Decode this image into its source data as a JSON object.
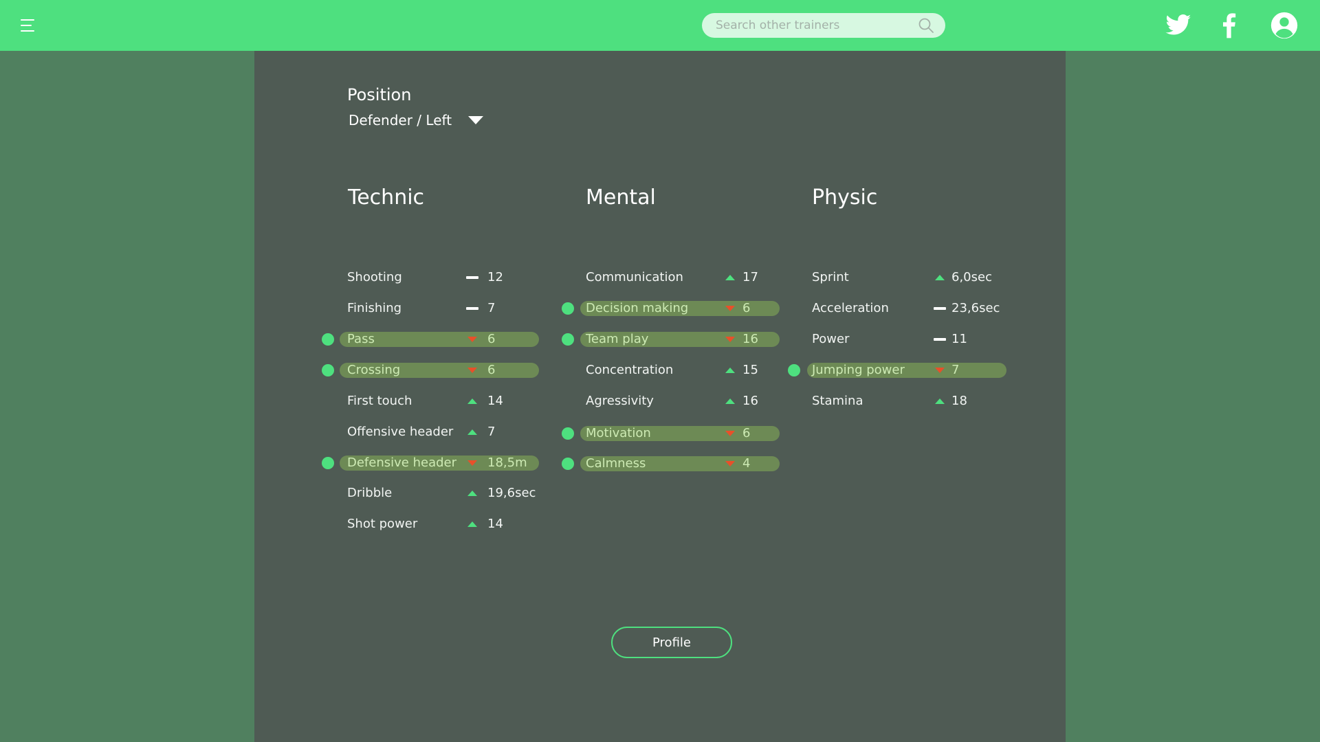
{
  "header": {
    "search": {
      "placeholder": "Search other trainers",
      "value": ""
    },
    "icons": [
      "menu-icon",
      "search-icon",
      "twitter-icon",
      "facebook-icon",
      "user-account-icon"
    ],
    "accent_color": "#4ee07f"
  },
  "position": {
    "label": "Position",
    "value": "Defender / Left"
  },
  "columns": [
    {
      "title": "Technic",
      "stats": [
        {
          "name": "Shooting",
          "trend": "flat",
          "value": "12",
          "flagged": false
        },
        {
          "name": "Finishing",
          "trend": "flat",
          "value": "7",
          "flagged": false
        },
        {
          "name": "Pass",
          "trend": "down",
          "value": "6",
          "flagged": true
        },
        {
          "name": "Crossing",
          "trend": "down",
          "value": "6",
          "flagged": true
        },
        {
          "name": "First touch",
          "trend": "up",
          "value": "14",
          "flagged": false
        },
        {
          "name": "Offensive header",
          "trend": "up",
          "value": "7",
          "flagged": false
        },
        {
          "name": "Defensive header",
          "trend": "down",
          "value": "18,5m",
          "flagged": true
        },
        {
          "name": "Dribble",
          "trend": "up",
          "value": "19,6sec",
          "flagged": false
        },
        {
          "name": "Shot power",
          "trend": "up",
          "value": "14",
          "flagged": false
        }
      ]
    },
    {
      "title": "Mental",
      "stats": [
        {
          "name": "Communication",
          "trend": "up",
          "value": "17",
          "flagged": false
        },
        {
          "name": "Decision making",
          "trend": "down",
          "value": "6",
          "flagged": true
        },
        {
          "name": "Team play",
          "trend": "down",
          "value": "16",
          "flagged": true
        },
        {
          "name": "Concentration",
          "trend": "up",
          "value": "15",
          "flagged": false
        },
        {
          "name": "Agressivity",
          "trend": "up",
          "value": "16",
          "flagged": false
        },
        {
          "name": "Motivation",
          "trend": "down",
          "value": "6",
          "flagged": true
        },
        {
          "name": "Calmness",
          "trend": "down",
          "value": "4",
          "flagged": true
        }
      ]
    },
    {
      "title": "Physic",
      "stats": [
        {
          "name": "Sprint",
          "trend": "up",
          "value": "6,0sec",
          "flagged": false
        },
        {
          "name": "Acceleration",
          "trend": "flat",
          "value": "23,6sec",
          "flagged": false
        },
        {
          "name": "Power",
          "trend": "flat",
          "value": "11",
          "flagged": false
        },
        {
          "name": "Jumping power",
          "trend": "down",
          "value": "7",
          "flagged": true
        },
        {
          "name": "Stamina",
          "trend": "up",
          "value": "18",
          "flagged": false
        }
      ]
    }
  ],
  "trend_colors": {
    "up": "#4ee07f",
    "down": "#e8502a",
    "flat": "#ffffff"
  },
  "profile_button": {
    "label": "Profile"
  }
}
